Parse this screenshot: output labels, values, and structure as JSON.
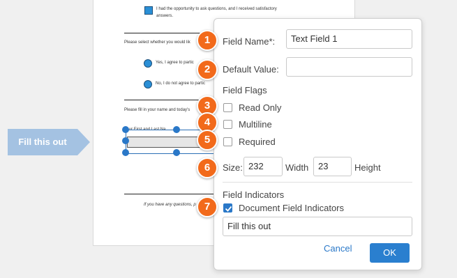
{
  "document": {
    "consent_text_line1": "I had the opportunity to ask questions, and I received satisfactory",
    "consent_text_line2": "answers.",
    "select_prompt": "Please select whether you would lik",
    "option_yes": "Yes, I agree to partic",
    "option_no": "No, I do not agree to partic",
    "fill_prompt": "Please fill in your name and today's",
    "field_caption": "Your First and Last Na",
    "footer_text": "If you have any questions, p"
  },
  "callout": {
    "label": "Fill this out",
    "color": "#a4c2e2"
  },
  "dialog": {
    "field_name_label": "Field Name*:",
    "field_name_value": "Text Field 1",
    "default_value_label": "Default Value:",
    "default_value_value": "",
    "field_flags_label": "Field Flags",
    "flags": [
      {
        "label": "Read Only",
        "checked": false
      },
      {
        "label": "Multiline",
        "checked": false
      },
      {
        "label": "Required",
        "checked": false
      }
    ],
    "size_label": "Size:",
    "width_value": "232",
    "width_label": "Width",
    "height_value": "23",
    "height_label": "Height",
    "field_indicators_label": "Field Indicators",
    "doc_indicators_label": "Document Field Indicators",
    "doc_indicators_checked": true,
    "indicator_text_value": "Fill this out",
    "cancel_label": "Cancel",
    "ok_label": "OK"
  },
  "badges": [
    "1",
    "2",
    "3",
    "4",
    "5",
    "6",
    "7"
  ],
  "colors": {
    "accent": "#2a78c8",
    "badge": "#f26a1b"
  }
}
